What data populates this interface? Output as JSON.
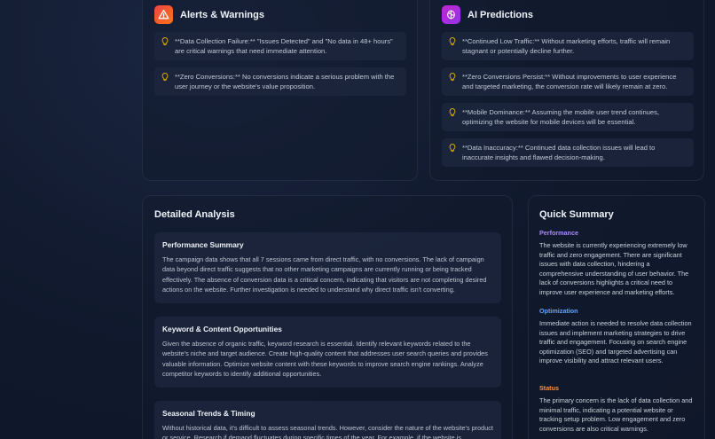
{
  "alerts": {
    "title": "Alerts & Warnings",
    "items": [
      "**Data Collection Failure:** \"Issues Detected\" and \"No data in 48+ hours\" are critical warnings that need immediate attention.",
      "**Zero Conversions:** No conversions indicate a serious problem with the user journey or the website's value proposition."
    ]
  },
  "predictions": {
    "title": "AI Predictions",
    "items": [
      "**Continued Low Traffic:** Without marketing efforts, traffic will remain stagnant or potentially decline further.",
      "**Zero Conversions Persist:** Without improvements to user experience and targeted marketing, the conversion rate will likely remain at zero.",
      "**Mobile Dominance:** Assuming the mobile user trend continues, optimizing the website for mobile devices will be essential.",
      "**Data Inaccuracy:** Continued data collection issues will lead to inaccurate insights and flawed decision-making."
    ]
  },
  "analysis": {
    "title": "Detailed Analysis",
    "cards": [
      {
        "title": "Performance Summary",
        "body": "The campaign data shows that all 7 sessions came from direct traffic, with no conversions. The lack of campaign data beyond direct traffic suggests that no other marketing campaigns are currently running or being tracked effectively. The absence of conversion data is a critical concern, indicating that visitors are not completing desired actions on the website. Further investigation is needed to understand why direct traffic isn't converting."
      },
      {
        "title": "Keyword & Content Opportunities",
        "body": "Given the absence of organic traffic, keyword research is essential. Identify relevant keywords related to the website's niche and target audience. Create high-quality content that addresses user search queries and provides valuable information. Optimize website content with these keywords to improve search engine rankings. Analyze competitor keywords to identify additional opportunities."
      },
      {
        "title": "Seasonal Trends & Timing",
        "body": "Without historical data, it's difficult to assess seasonal trends. However, consider the nature of the website's product or service. Research if demand fluctuates during specific times of the year. For example, if the website is"
      }
    ]
  },
  "summary": {
    "title": "Quick Summary",
    "sections": [
      {
        "label": "Performance",
        "color": "#a78bfa",
        "text": "The website is currently experiencing extremely low traffic and zero engagement. There are significant issues with data collection, hindering a comprehensive understanding of user behavior. The lack of conversions highlights a critical need to improve user experience and marketing efforts."
      },
      {
        "label": "Optimization",
        "color": "#60a5fa",
        "text": "Immediate action is needed to resolve data collection issues and implement marketing strategies to drive traffic and engagement. Focusing on search engine optimization (SEO) and targeted advertising can improve visibility and attract relevant users."
      },
      {
        "label": "Status",
        "color": "#fb923c",
        "text": "The primary concern is the lack of data collection and minimal traffic, indicating a potential website or tracking setup problem. Low engagement and zero conversions are also critical warnings."
      }
    ]
  },
  "colors": {
    "alert_icon": "#ef4444",
    "prediction_icon": "#c026d3",
    "bulb": "#eab308"
  }
}
